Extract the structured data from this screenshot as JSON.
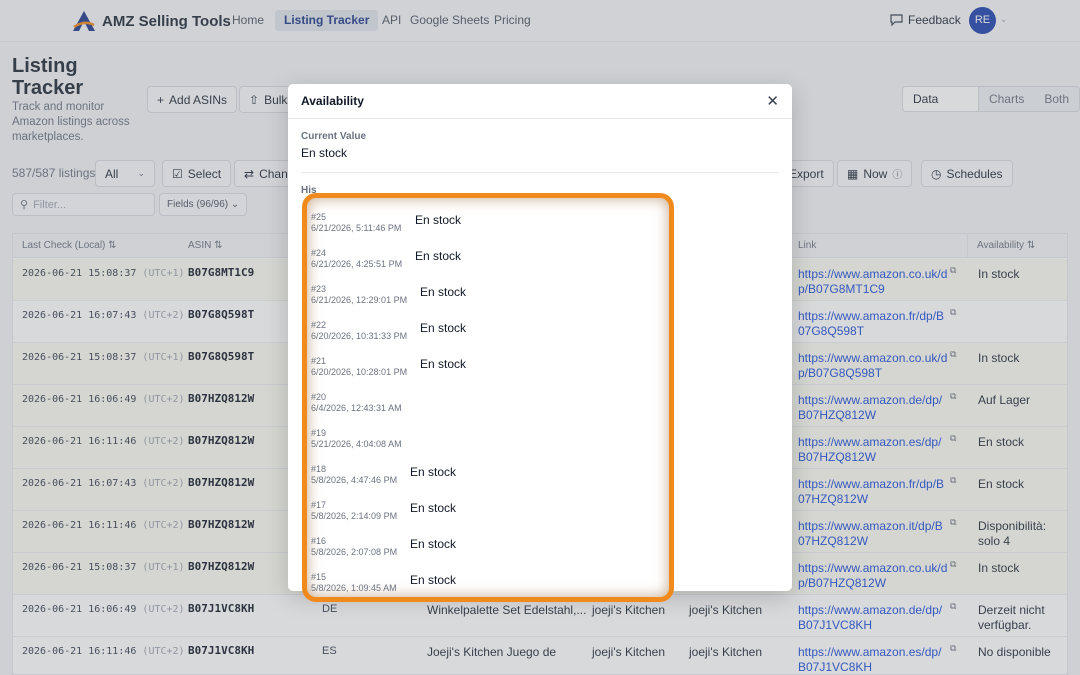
{
  "nav": {
    "brand": "AMZ Selling Tools",
    "links": [
      "Home",
      "Listing Tracker",
      "API",
      "Google Sheets",
      "Pricing"
    ],
    "feedback": "Feedback",
    "avatar": "RE"
  },
  "page": {
    "title": "Listing Tracker",
    "subtitle": "Track and monitor Amazon listings across marketplaces.",
    "buttons": {
      "add_asins": "Add ASINs",
      "bulk": "Bulk",
      "select": "Select",
      "change": "Chan",
      "export": "Export",
      "now": "Now",
      "schedules": "Schedules"
    },
    "view_tabs": [
      "Data Table",
      "Charts",
      "Both"
    ],
    "count": "587/587 listings",
    "scope": "All",
    "filter_placeholder": "Filter...",
    "fields": "Fields (96/96)"
  },
  "table": {
    "headers": [
      "Last Check (Local)",
      "ASIN",
      "Link",
      "Availability"
    ],
    "rows": [
      {
        "date": "2026-06-21 15:08:37",
        "tz": "(UTC+1)",
        "asin": "B07G8MT1C9",
        "market": "",
        "title": "",
        "brand": "",
        "seller": "",
        "link": "https://www.amazon.co.uk/dp/B07G8MT1C9",
        "avail": "In stock",
        "hl": true
      },
      {
        "date": "2026-06-21 16:07:43",
        "tz": "(UTC+2)",
        "asin": "B07G8Q598T",
        "market": "",
        "title": "",
        "brand": "",
        "seller": "",
        "link": "https://www.amazon.fr/dp/B07G8Q598T",
        "avail": "",
        "hl": false
      },
      {
        "date": "2026-06-21 15:08:37",
        "tz": "(UTC+1)",
        "asin": "B07G8Q598T",
        "market": "",
        "title": "",
        "brand": "",
        "seller": "",
        "link": "https://www.amazon.co.uk/dp/B07G8Q598T",
        "avail": "In stock",
        "hl": true
      },
      {
        "date": "2026-06-21 16:06:49",
        "tz": "(UTC+2)",
        "asin": "B07HZQ812W",
        "market": "",
        "title": "",
        "brand": "",
        "seller": "",
        "link": "https://www.amazon.de/dp/B07HZQ812W",
        "avail": "Auf Lager",
        "hl": true
      },
      {
        "date": "2026-06-21 16:11:46",
        "tz": "(UTC+2)",
        "asin": "B07HZQ812W",
        "market": "",
        "title": "",
        "brand": "",
        "seller": "",
        "link": "https://www.amazon.es/dp/B07HZQ812W",
        "avail": "En stock",
        "hl": true
      },
      {
        "date": "2026-06-21 16:07:43",
        "tz": "(UTC+2)",
        "asin": "B07HZQ812W",
        "market": "",
        "title": "",
        "brand": "",
        "seller": "",
        "link": "https://www.amazon.fr/dp/B07HZQ812W",
        "avail": "En stock",
        "hl": true
      },
      {
        "date": "2026-06-21 16:11:46",
        "tz": "(UTC+2)",
        "asin": "B07HZQ812W",
        "market": "",
        "title": "",
        "brand": "",
        "seller": "",
        "link": "https://www.amazon.it/dp/B07HZQ812W",
        "avail": "Disponibilità: solo 4",
        "hl": true
      },
      {
        "date": "2026-06-21 15:08:37",
        "tz": "(UTC+1)",
        "asin": "B07HZQ812W",
        "market": "",
        "title": "",
        "brand": "",
        "seller": "",
        "link": "https://www.amazon.co.uk/dp/B07HZQ812W",
        "avail": "In stock",
        "hl": true
      },
      {
        "date": "2026-06-21 16:06:49",
        "tz": "(UTC+2)",
        "asin": "B07J1VC8KH",
        "market": "DE",
        "title": "Winkelpalette Set Edelstahl,...",
        "brand": "joeji's Kitchen",
        "seller": "joeji's Kitchen",
        "link": "https://www.amazon.de/dp/B07J1VC8KH",
        "avail": "Derzeit nicht verfügbar.",
        "hl": false
      },
      {
        "date": "2026-06-21 16:11:46",
        "tz": "(UTC+2)",
        "asin": "B07J1VC8KH",
        "market": "ES",
        "title": "Joeji's Kitchen Juego de",
        "brand": "joeji's Kitchen",
        "seller": "joeji's Kitchen",
        "link": "https://www.amazon.es/dp/B07J1VC8KH",
        "avail": "No disponible",
        "hl": false
      }
    ]
  },
  "modal": {
    "title": "Availability",
    "current_label": "Current Value",
    "current_value": "En stock",
    "history_label": "His",
    "history": [
      {
        "num": "#25",
        "time": "6/21/2026, 5:11:46 PM",
        "value": "En stock"
      },
      {
        "num": "#24",
        "time": "6/21/2026, 4:25:51 PM",
        "value": "En stock"
      },
      {
        "num": "#23",
        "time": "6/21/2026, 12:29:01 PM",
        "value": "En stock"
      },
      {
        "num": "#22",
        "time": "6/20/2026, 10:31:33 PM",
        "value": "En stock"
      },
      {
        "num": "#21",
        "time": "6/20/2026, 10:28:01 PM",
        "value": "En stock"
      },
      {
        "num": "#20",
        "time": "6/4/2026, 12:43:31 AM",
        "value": ""
      },
      {
        "num": "#19",
        "time": "5/21/2026, 4:04:08 AM",
        "value": ""
      },
      {
        "num": "#18",
        "time": "5/8/2026, 4:47:46 PM",
        "value": "En stock"
      },
      {
        "num": "#17",
        "time": "5/8/2026, 2:14:09 PM",
        "value": "En stock"
      },
      {
        "num": "#16",
        "time": "5/8/2026, 2:07:08 PM",
        "value": "En stock"
      },
      {
        "num": "#15",
        "time": "5/8/2026, 1:09:45 AM",
        "value": "En stock"
      }
    ]
  },
  "colors": {
    "accent": "#1e3a8a",
    "highlight_border": "#f08a1c",
    "link": "#1d4ed8"
  }
}
